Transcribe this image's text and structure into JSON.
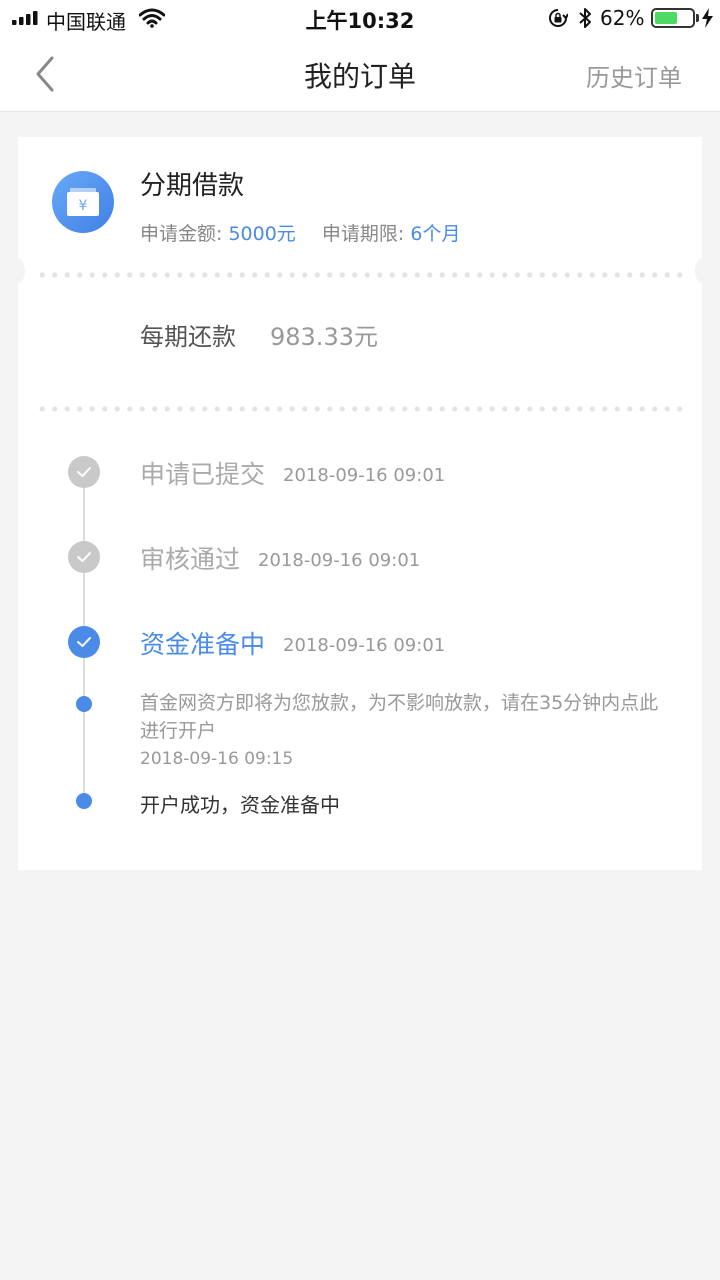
{
  "status_bar": {
    "carrier": "中国联通",
    "time": "上午10:32",
    "battery_percent_text": "62%",
    "battery_level": 0.62,
    "battery_color": "#4cd964"
  },
  "nav": {
    "back_icon": "chevron-left-icon",
    "title": "我的订单",
    "history_label": "历史订单"
  },
  "order": {
    "product_icon": "wallet-yen-icon",
    "product_name": "分期借款",
    "amount_label": "申请金额:",
    "amount_value": "5000元",
    "term_label": "申请期限:",
    "term_value": "6个月",
    "repay_label": "每期还款",
    "repay_value": "983.33元"
  },
  "timeline": {
    "steps": [
      {
        "title": "申请已提交",
        "time": "2018-09-16 09:01"
      },
      {
        "title": "审核通过",
        "time": "2018-09-16 09:01"
      },
      {
        "title": "资金准备中",
        "time": "2018-09-16 09:01"
      }
    ],
    "sub_events": [
      {
        "text": "首金网资方即将为您放款，为不影响放款，请在35分钟内点此进行开户",
        "time": "2018-09-16 09:15"
      },
      {
        "text": "开户成功，资金准备中"
      }
    ]
  },
  "colors": {
    "accent": "#4a8be8",
    "inactive": "#c9c9c9",
    "background": "#f4f4f4"
  }
}
